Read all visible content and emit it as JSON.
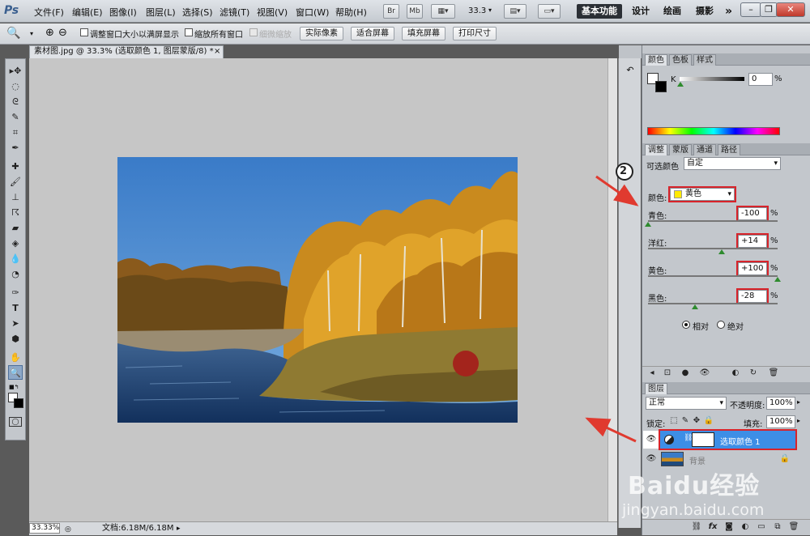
{
  "app": {
    "logo": "Ps"
  },
  "menu": [
    "文件(F)",
    "编辑(E)",
    "图像(I)",
    "图层(L)",
    "选择(S)",
    "滤镜(T)",
    "视图(V)",
    "窗口(W)",
    "帮助(H)"
  ],
  "menubar_buttons": {
    "br": "Br",
    "mb": "Mb",
    "zoom": "33.3"
  },
  "workspaces": {
    "active": "基本功能",
    "design": "设计",
    "painting": "绘画",
    "photography": "摄影",
    "more": "»"
  },
  "window_controls": {
    "min": "–",
    "restore": "❐",
    "close": "✕"
  },
  "options": {
    "resize_windows": "调整窗口大小以满屏显示",
    "zoom_all": "缩放所有窗口",
    "scrubby_zoom": "细微缩放",
    "actual_pixels": "实际像素",
    "fit_screen": "适合屏幕",
    "fill_screen": "填充屏幕",
    "print_size": "打印尺寸"
  },
  "document": {
    "tab_title": "素材图.jpg @ 33.3% (选取颜色 1, 图层蒙版/8) *",
    "tab_close": "×",
    "zoom_status": "33.33%",
    "doc_status": "文档:6.18M/6.18M"
  },
  "color_panel": {
    "tabs": [
      "颜色",
      "色板",
      "样式"
    ],
    "channel": "K",
    "value": "0",
    "unit": "%"
  },
  "adjust_panel": {
    "tabs": [
      "调整",
      "蒙版",
      "通道",
      "路径"
    ],
    "title": "可选颜色",
    "preset": "自定",
    "color_label": "颜色:",
    "color_value": "黄色",
    "sliders": [
      {
        "label": "青色:",
        "value": "-100",
        "unit": "%",
        "pos": 0.0
      },
      {
        "label": "洋红:",
        "value": "+14",
        "unit": "%",
        "pos": 0.57
      },
      {
        "label": "黄色:",
        "value": "+100",
        "unit": "%",
        "pos": 1.0
      },
      {
        "label": "黑色:",
        "value": "-28",
        "unit": "%",
        "pos": 0.36
      }
    ],
    "relative": "相对",
    "absolute": "绝对",
    "method": "relative"
  },
  "layers_panel": {
    "tab": "图层",
    "blend_mode": "正常",
    "opacity_label": "不透明度:",
    "opacity": "100%",
    "lock_label": "锁定:",
    "fill_label": "填充:",
    "fill": "100%",
    "layers": [
      {
        "name": "选取颜色 1",
        "selected": true
      },
      {
        "name": "背景",
        "selected": false
      }
    ],
    "bottom_icons": [
      "link-icon",
      "fx-icon",
      "mask-icon",
      "adjustment-icon",
      "folder-icon",
      "new-layer-icon",
      "trash-icon"
    ]
  },
  "annotations": {
    "step_number": "2"
  },
  "watermark": {
    "brand": "Baidu经验",
    "url": "jingyan.baidu.com"
  },
  "colors": {
    "accent_red": "#d8232a",
    "selection_blue": "#3d8ee6",
    "canvas_gray": "#c6c6c6"
  }
}
